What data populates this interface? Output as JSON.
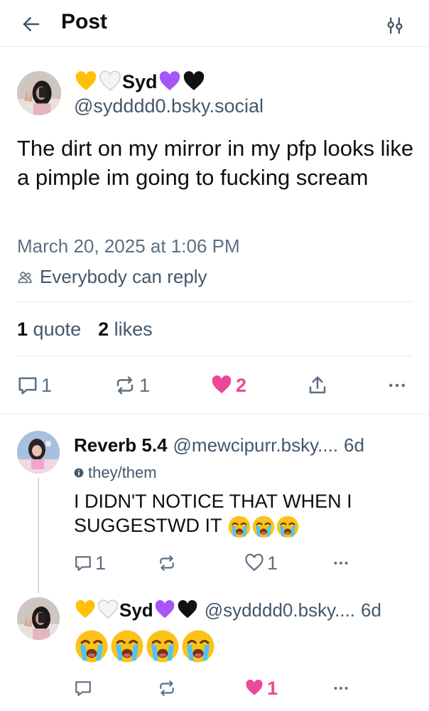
{
  "header": {
    "title": "Post"
  },
  "post": {
    "author_name": "Syd",
    "handle": "@sydddd0.bsky.social",
    "text": "The dirt on my mirror in my pfp looks like a pimple im going to fucking scream",
    "date": "March 20, 2025 at 1:06 PM",
    "reply_permission": "Everybody can reply",
    "quote_count": "1",
    "quote_label": "quote",
    "like_count": "2",
    "like_label": "likes",
    "actions": {
      "reply_count": "1",
      "repost_count": "1",
      "like_count": "2"
    }
  },
  "replies": [
    {
      "author_name": "Reverb 5.4",
      "handle": "@mewcipurr.bsky....",
      "time": "6d",
      "pronouns": "they/them",
      "text": "I DIDN'T NOTICE THAT WHEN I SUGGESTWD IT",
      "actions": {
        "reply_count": "1",
        "repost_count": "",
        "like_count": "1"
      }
    },
    {
      "author_name": "Syd",
      "handle": "@sydddd0.bsky....",
      "time": "6d",
      "actions": {
        "reply_count": "",
        "repost_count": "",
        "like_count": "1"
      }
    }
  ],
  "icons": {
    "back": "arrow-left-icon",
    "settings": "sliders-icon",
    "reply": "comment-icon",
    "repost": "repost-icon",
    "like": "heart-icon",
    "share": "share-icon",
    "more": "ellipsis-icon",
    "people": "people-icon"
  },
  "colors": {
    "like_pink": "#ec4899",
    "muted": "#5b6f83",
    "border": "#e7eaee"
  }
}
